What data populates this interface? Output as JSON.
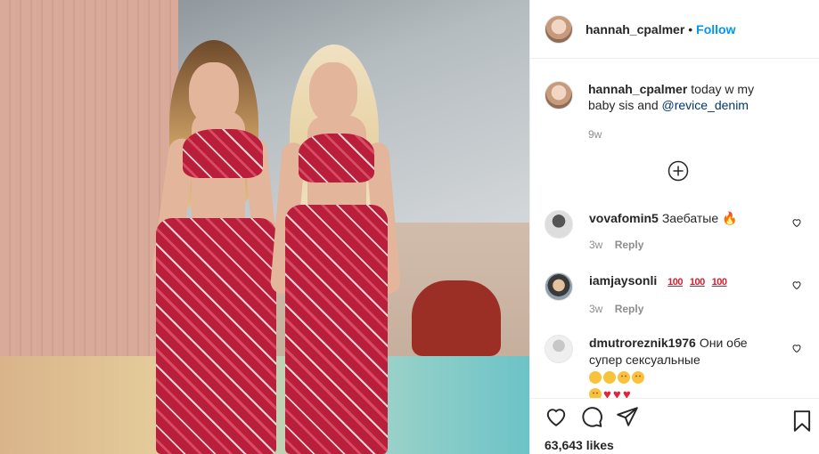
{
  "author": {
    "username": "hannah_cpalmer",
    "separator": "•",
    "follow_label": "Follow"
  },
  "caption": {
    "username": "hannah_cpalmer",
    "text": "today w my baby sis and",
    "mention": "@revice_denim",
    "time": "9w"
  },
  "comments": [
    {
      "username": "vovafomin5",
      "text": "Заебатые 🔥",
      "time": "3w",
      "reply_label": "Reply"
    },
    {
      "username": "iamjaysonli",
      "badges": [
        "100",
        "100",
        "100"
      ],
      "time": "3w",
      "reply_label": "Reply"
    },
    {
      "username": "dmutroreznik1976",
      "text": "Они обе супер сексуальные"
    }
  ],
  "likes": "63,643 likes",
  "icons": [
    "heart-icon",
    "comment-icon",
    "share-icon",
    "bookmark-icon",
    "plus-circle-icon"
  ],
  "colors": {
    "accent": "#0095f6",
    "text": "#262626",
    "muted": "#8e8e8e",
    "heart": "#e0243a"
  }
}
